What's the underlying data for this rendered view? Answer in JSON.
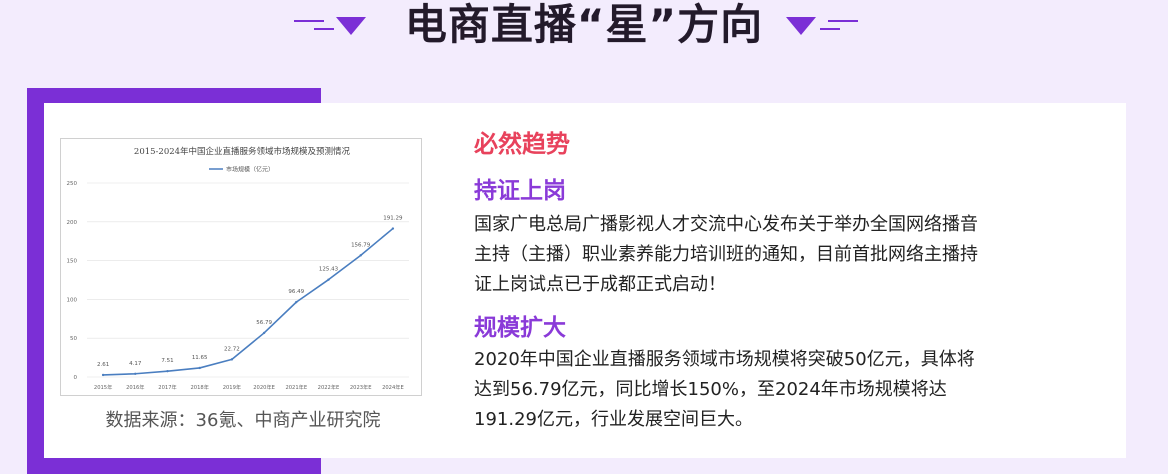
{
  "page": {
    "heading": "电商直播“星”方向",
    "accent_color": "#7b2fd6",
    "highlight_color": "#e8425c",
    "subtitle_color": "#8a3ad8"
  },
  "chart_data": {
    "type": "line",
    "title": "2015-2024年中国企业直播服务领域市场规模及预测情况",
    "legend": [
      "市场规模（亿元）"
    ],
    "legend_position": "top-center",
    "categories": [
      "2015年",
      "2016年",
      "2017年",
      "2018年",
      "2019年",
      "2020年E",
      "2021年E",
      "2022年E",
      "2023年E",
      "2024年E"
    ],
    "series": [
      {
        "name": "市场规模（亿元）",
        "values": [
          2.61,
          4.17,
          7.51,
          11.65,
          22.72,
          56.79,
          96.49,
          125.43,
          156.79,
          191.29
        ],
        "color": "#4a7ec0"
      }
    ],
    "data_labels": [
      "2.61",
      "4.17",
      "7.51",
      "11.65",
      "22.72",
      "56.79",
      "96.49",
      "125.43",
      "156.79",
      "191.29"
    ],
    "y_ticks": [
      "0",
      "50",
      "100",
      "150",
      "200",
      "250"
    ],
    "ylim": [
      0,
      250
    ],
    "grid": true
  },
  "source": "数据来源：36氪、中商产业研究院",
  "right": {
    "section_title": "必然趋势",
    "items": [
      {
        "title": "持证上岗",
        "text": "国家广电总局广播影视人才交流中心发布关于举办全国网络播音\n主持（主播）职业素养能力培训班的通知，目前首批网络主播持\n证上岗试点已于成都正式启动！"
      },
      {
        "title": "规模扩大",
        "text": "2020年中国企业直播服务领域市场规模将突破50亿元，具体将\n达到56.79亿元，同比增长150%，至2024年市场规模将达\n191.29亿元，行业发展空间巨大。"
      }
    ]
  }
}
